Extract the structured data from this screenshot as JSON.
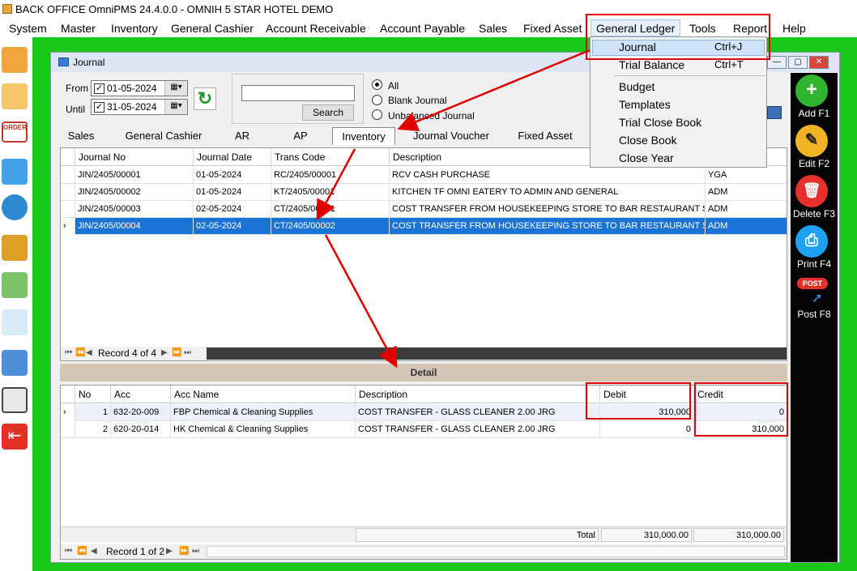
{
  "title": "BACK OFFICE OmniPMS 24.4.0.0 - OMNIH 5 STAR HOTEL DEMO",
  "menu": [
    "System",
    "Master",
    "Inventory",
    "General Cashier",
    "Account Receivable",
    "Account Payable",
    "Sales",
    "Fixed Asset",
    "General Ledger",
    "Tools",
    "Report",
    "Help"
  ],
  "dropdown": {
    "items": [
      {
        "label": "Journal",
        "shortcut": "Ctrl+J"
      },
      {
        "label": "Trial Balance",
        "shortcut": "Ctrl+T"
      },
      {
        "label": "Budget",
        "shortcut": ""
      },
      {
        "label": "Templates",
        "shortcut": ""
      },
      {
        "label": "Trial Close Book",
        "shortcut": ""
      },
      {
        "label": "Close Book",
        "shortcut": ""
      },
      {
        "label": "Close Year",
        "shortcut": ""
      }
    ]
  },
  "window": {
    "title": "Journal",
    "from_label": "From",
    "until_label": "Until",
    "from_date": "01-05-2024",
    "until_date": "31-05-2024",
    "search_value": "",
    "search_button": "Search",
    "filters": [
      "All",
      "Blank Journal",
      "Unbalanced Journal"
    ],
    "selected_filter": "All"
  },
  "tabs": [
    "Sales",
    "General Cashier",
    "AR",
    "AP",
    "Inventory",
    "Journal Voucher",
    "Fixed Asset"
  ],
  "selected_tab": "Inventory",
  "journal_grid": {
    "columns": [
      "Journal No",
      "Journal Date",
      "Trans Code",
      "Description",
      ""
    ],
    "rows": [
      [
        "JIN/2405/00001",
        "01-05-2024",
        "RC/2405/00001",
        "RCV CASH PURCHASE",
        "YGA"
      ],
      [
        "JIN/2405/00002",
        "01-05-2024",
        "KT/2405/00001",
        "KITCHEN TF OMNI EATERY TO ADMIN AND GENERAL",
        "ADM"
      ],
      [
        "JIN/2405/00003",
        "02-05-2024",
        "CT/2405/00001",
        "COST TRANSFER FROM HOUSEKEEPING STORE TO BAR RESTAURANT STORE",
        "ADM"
      ],
      [
        "JIN/2405/00004",
        "02-05-2024",
        "CT/2405/00002",
        "COST TRANSFER FROM HOUSEKEEPING STORE TO BAR RESTAURANT STORE",
        "ADM"
      ]
    ],
    "record_text": "Record 4 of 4"
  },
  "detail": {
    "title": "Detail",
    "columns": [
      "No",
      "Acc",
      "Acc Name",
      "Description",
      "Debit",
      "Credit"
    ],
    "rows": [
      [
        "1",
        "632-20-009",
        "FBP Chemical & Cleaning Supplies",
        "COST TRANSFER - GLASS CLEANER 2.00 JRG",
        "310,000",
        "0"
      ],
      [
        "2",
        "620-20-014",
        "HK Chemical & Cleaning Supplies",
        "COST TRANSFER - GLASS CLEANER 2.00 JRG",
        "0",
        "310,000"
      ]
    ],
    "total_label": "Total",
    "total_debit": "310,000.00",
    "total_credit": "310,000.00",
    "record_text": "Record 1 of 2"
  },
  "toolbar": [
    {
      "label": "Add F1",
      "color": "#2fb52f",
      "icon": "plus-icon",
      "glyph": "+"
    },
    {
      "label": "Edit F2",
      "color": "#f0b323",
      "icon": "edit-icon",
      "glyph": "✎"
    },
    {
      "label": "Delete F3",
      "color": "#e8302a",
      "icon": "trash-icon",
      "glyph": "🗑"
    },
    {
      "label": "Print F4",
      "color": "#1da1f2",
      "icon": "printer-icon",
      "glyph": "⎙"
    },
    {
      "label": "Post F8",
      "color": "#e8302a",
      "icon": "post-icon",
      "glyph": "POST"
    }
  ]
}
